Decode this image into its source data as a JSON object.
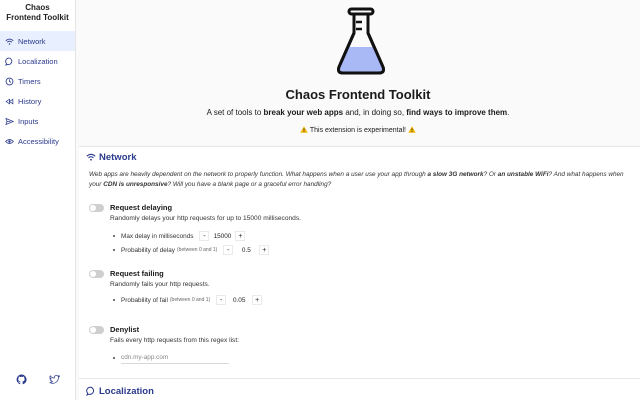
{
  "app": {
    "brand_line1": "Chaos",
    "brand_line2": "Frontend Toolkit"
  },
  "sidebar": {
    "items": [
      {
        "label": "Network",
        "icon": "wifi-icon",
        "active": true
      },
      {
        "label": "Localization",
        "icon": "chat-bubble-icon",
        "active": false
      },
      {
        "label": "Timers",
        "icon": "clock-icon",
        "active": false
      },
      {
        "label": "History",
        "icon": "rewind-icon",
        "active": false
      },
      {
        "label": "Inputs",
        "icon": "send-icon",
        "active": false
      },
      {
        "label": "Accessibility",
        "icon": "eye-icon",
        "active": false
      }
    ],
    "footer": {
      "github_icon": "github-icon",
      "twitter_icon": "twitter-icon"
    }
  },
  "hero": {
    "title": "Chaos Frontend Toolkit",
    "desc_part1": "A set of tools to ",
    "desc_bold1": "break your web apps",
    "desc_part2": " and, in doing so, ",
    "desc_bold2": "find ways to improve them",
    "desc_part3": ".",
    "warning": "This extension is experimental!",
    "accent": "#2b3a8c",
    "flask_liquid": "#a9b9f5"
  },
  "network": {
    "title": "Network",
    "desc_1": "Web apps are heavily dependent on the network to properly function. What happens when a user use your app through ",
    "desc_b1": "a slow 3G network",
    "desc_2": "? Or ",
    "desc_b2": "an unstable WiFi",
    "desc_3": "? And what happens when your ",
    "desc_b3": "CDN is unresponsive",
    "desc_4": "? Will you have a blank page or a graceful error handling?",
    "delay": {
      "title": "Request delaying",
      "desc": "Randomly delays your http requests for up to 15000 milliseconds.",
      "max_label": "Max delay in milliseconds",
      "max_value": "15000",
      "prob_label": "Probability of delay",
      "prob_hint": "(between 0 and 1)",
      "prob_value": "0.5"
    },
    "failing": {
      "title": "Request failing",
      "desc": "Randomly fails your http requests.",
      "prob_label": "Probability of fail",
      "prob_hint": "(between 0 and 1)",
      "prob_value": "0.05"
    },
    "denylist": {
      "title": "Denylist",
      "desc": "Fails every http requests from this regex list:",
      "placeholder": "cdn.my-app.com"
    },
    "stepper_minus": "-",
    "stepper_plus": "+"
  },
  "localization": {
    "title": "Localization"
  }
}
